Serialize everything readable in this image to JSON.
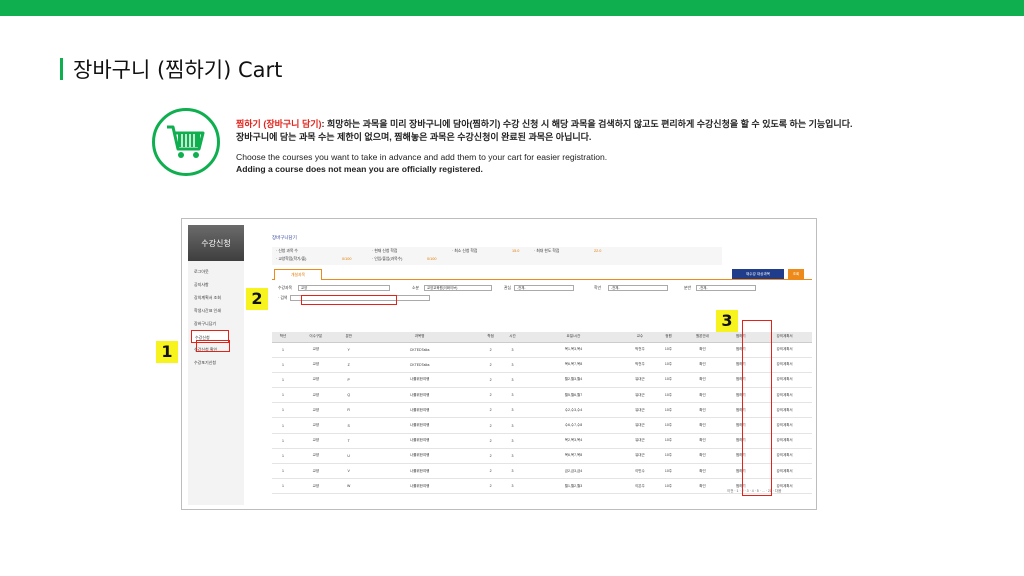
{
  "page": {
    "title": "장바구니 (찜하기) Cart",
    "desc_red": "찜하기 (장바구니 담기)",
    "desc_rest_1": ": 희망하는 과목을 미리 장바구니에 담아(찜하기) 수강 신청 시 해당 과목을 검색하지 않고도 편리하게 수강신청을 할 수 있도록 하는 기능입니다.",
    "desc_line_2": "장바구니에 담는 과목 수는 제한이 없으며, 찜해놓은 과목은 수강신청이 완료된 과목은 아닙니다.",
    "desc_en_1": "Choose the courses you want to take in advance and add them to your cart for easier registration.",
    "desc_en_2": "Adding a course does not mean you are officially registered."
  },
  "markers": {
    "m1": "1",
    "m2": "2",
    "m3": "3"
  },
  "app": {
    "sidebar_title": "수강신청",
    "menu": [
      "로그아웃",
      "공지사항",
      "강의계획서 조회",
      "학생시간표 인쇄",
      "장바구니담기",
      "수강신청",
      "수강신청 확인",
      "수강포기신청"
    ],
    "breadcrumb": "장바구니담기",
    "info": {
      "l1": "· 신청 과목 수",
      "l2": "· 현재 신청 학점",
      "l3": "· 최소 신청 학점",
      "v3": "15.0",
      "l4": "· 최대 한도 학점",
      "v4": "22.0",
      "l5": "· 교양학점(학기/졸)",
      "v5": "0/100",
      "l6": "· 인입/졸업(과목수)",
      "v6": "0/100"
    },
    "tab_label": "개설과목",
    "btn_cart": "재수강 대상과목",
    "btn_search": "조회",
    "filters": {
      "l1": "수강과목",
      "s1": "교양",
      "l2": "소분",
      "s2": "교양교육원(이화이브)",
      "l3": "관심",
      "s3": "-전체-",
      "l4": "학년",
      "s4": "-전체-",
      "l5": "분반",
      "s5": "-전체-",
      "l6": "· 검색"
    },
    "headers": [
      "학년",
      "이수구분",
      "분반",
      "과목명",
      "학점",
      "시간",
      "요일/시간",
      "교수",
      "정원",
      "원본안내",
      "찜하기",
      "강의계획서"
    ],
    "rows": [
      [
        "1",
        "교양",
        "Y",
        "CKTEDTalks",
        "2",
        "3",
        "목1,목3,목4",
        "박천주",
        "10주",
        "확인",
        "찜하기",
        "강의계획서"
      ],
      [
        "1",
        "교양",
        "Z",
        "CKTEDTalks",
        "2",
        "3",
        "목6,목7,목8",
        "박천주",
        "10주",
        "확인",
        "찜하기",
        "강의계획서"
      ],
      [
        "1",
        "교양",
        "P",
        "나를위한여행",
        "2",
        "3",
        "월2,월3,월4",
        "유대근",
        "10주",
        "확인",
        "찜하기",
        "강의계획서"
      ],
      [
        "1",
        "교양",
        "Q",
        "나를위한여행",
        "2",
        "3",
        "월5,월6,월7",
        "유대근",
        "10주",
        "확인",
        "찜하기",
        "강의계획서"
      ],
      [
        "1",
        "교양",
        "R",
        "나를위한여행",
        "2",
        "3",
        "수2,수3,수4",
        "유대근",
        "10주",
        "확인",
        "찜하기",
        "강의계획서"
      ],
      [
        "1",
        "교양",
        "S",
        "나를위한여행",
        "2",
        "3",
        "수6,수7,수8",
        "유대근",
        "10주",
        "확인",
        "찜하기",
        "강의계획서"
      ],
      [
        "1",
        "교양",
        "T",
        "나를위한여행",
        "2",
        "3",
        "목2,목3,목4",
        "유대근",
        "10주",
        "확인",
        "찜하기",
        "강의계획서"
      ],
      [
        "1",
        "교양",
        "U",
        "나를위한여행",
        "2",
        "3",
        "목6,목7,목8",
        "유대근",
        "10주",
        "확인",
        "찜하기",
        "강의계획서"
      ],
      [
        "1",
        "교양",
        "V",
        "나를위한여행",
        "2",
        "3",
        "금2,금3,금4",
        "이민수",
        "10주",
        "확인",
        "찜하기",
        "강의계획서"
      ],
      [
        "1",
        "교양",
        "W",
        "나를위한여행",
        "2",
        "3",
        "월1,월2,월3",
        "이은주",
        "10주",
        "확인",
        "찜하기",
        "강의계획서"
      ]
    ],
    "pager": "이전 · 1 · 2 · 3 · 4 · 5 · ... · 21 · 다음"
  },
  "colors": {
    "brand_green": "#0fae4f",
    "accent_red": "#e2231a",
    "orange": "#ee8a1a",
    "navy": "#1f3d8b",
    "marker_yellow": "#f7f31e"
  }
}
